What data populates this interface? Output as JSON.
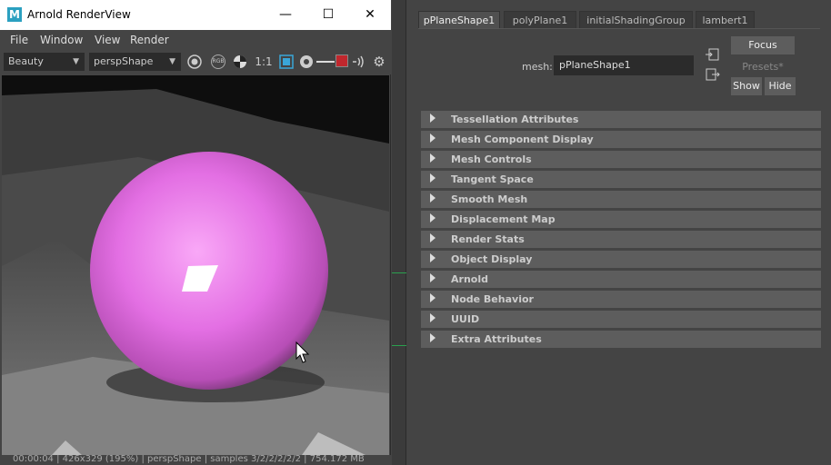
{
  "render_view": {
    "title": "Arnold RenderView",
    "logo": "M",
    "window_controls": {
      "minimize": "—",
      "maximize": "☐",
      "close": "✕"
    },
    "menus": [
      "File",
      "Window",
      "View",
      "Render"
    ],
    "toolbar": {
      "aov": "Beauty",
      "camera": "perspShape",
      "rgb_label": "RGB",
      "ratio": "1:1"
    },
    "status": "00:00:04 | 426x329 (195%) | perspShape | samples 3/2/2/2/2/2 | 754.172 MB"
  },
  "attribute_editor": {
    "tabs": [
      "pPlaneShape1",
      "polyPlane1",
      "initialShadingGroup",
      "lambert1"
    ],
    "active_tab": "pPlaneShape1",
    "mesh_label": "mesh:",
    "mesh_value": "pPlaneShape1",
    "focus_label": "Focus",
    "presets_label": "Presets*",
    "show_label": "Show",
    "hide_label": "Hide",
    "sections": [
      "Tessellation Attributes",
      "Mesh Component Display",
      "Mesh Controls",
      "Tangent Space",
      "Smooth Mesh",
      "Displacement Map",
      "Render Stats",
      "Object Display",
      "Arnold",
      "Node Behavior",
      "UUID",
      "Extra Attributes"
    ]
  },
  "colors": {
    "panel_bg": "#444444",
    "sphere": "#e36fe3",
    "section_bar": "#5d5d5d",
    "accent_red": "#c0272d"
  },
  "icons": [
    "maya-logo-icon",
    "exposure-icon",
    "rgb-icon",
    "contrast-icon",
    "region-icon",
    "aperture-icon",
    "color-swatch-icon",
    "audio-icon",
    "gear-icon",
    "cursor-icon"
  ]
}
